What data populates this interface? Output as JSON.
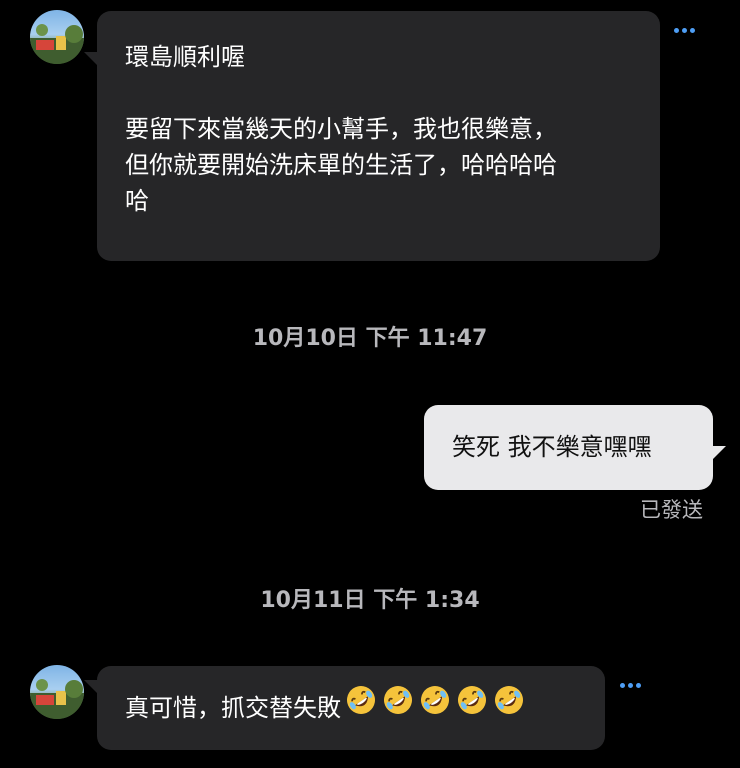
{
  "conversation": {
    "messages": [
      {
        "direction": "incoming",
        "lines": [
          "環島順利喔",
          "",
          "要留下來當幾天的小幫手，我也很樂意，",
          "但你就要開始洗床單的生活了，哈哈哈哈",
          "哈"
        ]
      },
      {
        "direction": "timestamp",
        "text": "10月10日 下午 11:47"
      },
      {
        "direction": "outgoing",
        "text": "笑死 我不樂意嘿嘿",
        "status": "已發送"
      },
      {
        "direction": "timestamp",
        "text": "10月11日 下午 1:34"
      },
      {
        "direction": "incoming",
        "text": "真可惜，抓交替失敗",
        "emojis": [
          "rolling-on-floor-laughing",
          "rolling-on-floor-laughing",
          "rolling-on-floor-laughing",
          "rolling-on-floor-laughing",
          "rolling-on-floor-laughing"
        ]
      }
    ]
  },
  "colors": {
    "background": "#000000",
    "incoming_bubble": "#262628",
    "outgoing_bubble": "#e9e9eb",
    "timestamp_text": "#b8b8bc",
    "more_dots": "#4e9ef5"
  },
  "icons": {
    "more": "more-horizontal-icon",
    "emoji": "rolling-on-floor-laughing"
  }
}
